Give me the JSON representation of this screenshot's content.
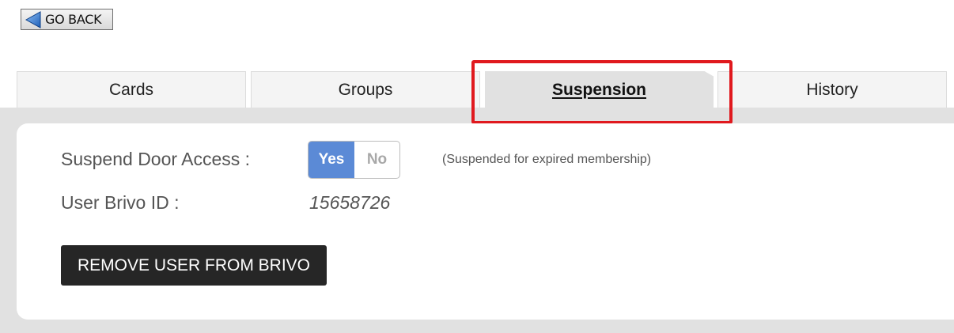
{
  "go_back": {
    "label": "GO BACK",
    "icon": "arrow-left-icon",
    "icon_color": "#2f74c9"
  },
  "tabs": [
    {
      "label": "Cards",
      "active": false
    },
    {
      "label": "Groups",
      "active": false
    },
    {
      "label": "Suspension",
      "active": true
    },
    {
      "label": "History",
      "active": false
    }
  ],
  "highlight_color": "#e0191e",
  "form": {
    "suspend_label": "Suspend Door Access :",
    "toggle": {
      "yes": "Yes",
      "no": "No",
      "selected": "Yes",
      "selected_color": "#5b8ad6"
    },
    "suspend_note": "(Suspended for expired membership)",
    "brivo_label": "User Brivo ID :",
    "brivo_id": "15658726"
  },
  "remove_button_label": "REMOVE USER FROM BRIVO"
}
